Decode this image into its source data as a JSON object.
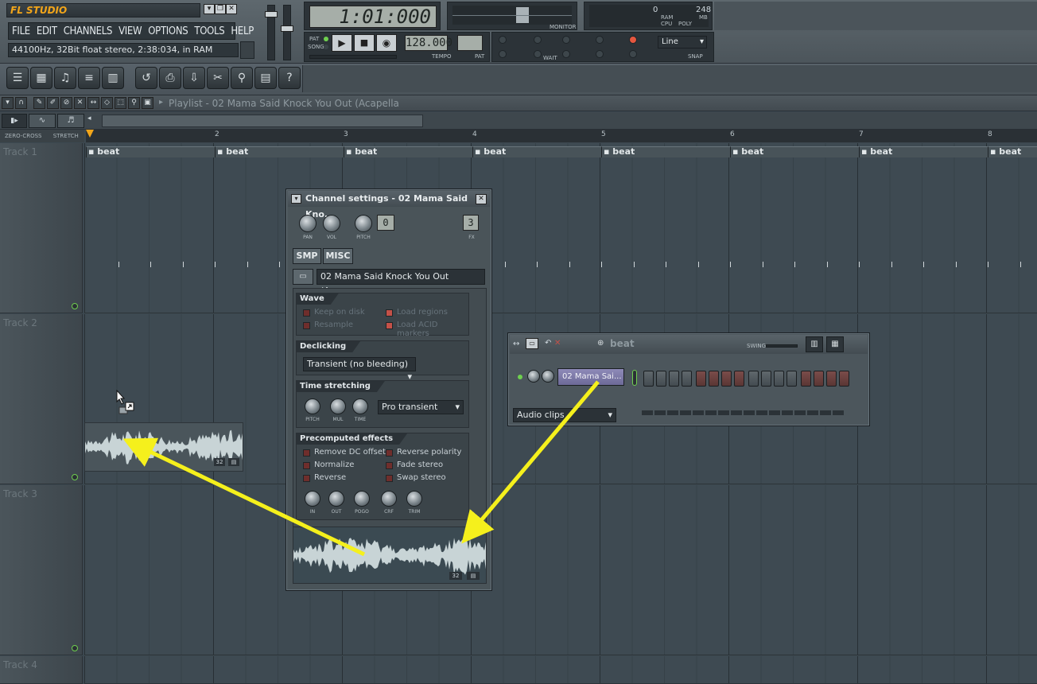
{
  "app": {
    "title": "FL STUDIO",
    "menu": [
      "FILE",
      "EDIT",
      "CHANNELS",
      "VIEW",
      "OPTIONS",
      "TOOLS",
      "HELP"
    ],
    "info": "44100Hz, 32Bit float stereo, 2:38:034, in RAM"
  },
  "transport": {
    "time": "1:01:000",
    "tempo": "128.000",
    "tempo_label": "TEMPO",
    "pat_label": "PAT",
    "song_label": "SONG",
    "pat_box_label": "PAT",
    "monitor_label": "MONITOR",
    "wait_label": "WAIT",
    "ram_value": "0",
    "ram_label": "RAM",
    "mb_label": "MB",
    "cpu_label": "CPU",
    "poly_label": "POLY",
    "poly_value": "248",
    "snap_value": "Line",
    "snap_label": "SNAP"
  },
  "playlist": {
    "title": "Playlist - 02 Mama Said Knock You Out (Acapella",
    "zero_cross": "ZERO-CROSS",
    "stretch": "STRETCH",
    "ruler": [
      "2",
      "3",
      "4",
      "5",
      "6",
      "7",
      "8"
    ],
    "pattern_label": "beat",
    "tracks": [
      "Track 1",
      "Track 2",
      "Track 3",
      "Track 4"
    ],
    "clip_badge": "32"
  },
  "channel_settings": {
    "title": "Channel settings - 02 Mama Said Kno...",
    "knobs_top": [
      "PAN",
      "VOL",
      "PITCH"
    ],
    "pitch_value": "0",
    "fx_value": "3",
    "fx_label": "FX",
    "tabs": [
      "SMP",
      "MISC"
    ],
    "sample_name": "02 Mama Said Knock You Out (Acap...",
    "wave": {
      "title": "Wave",
      "options": [
        "Keep on disk",
        "Resample",
        "Load regions",
        "Load ACID markers"
      ]
    },
    "declicking": {
      "title": "Declicking",
      "value": "Transient (no bleeding)"
    },
    "time_stretching": {
      "title": "Time stretching",
      "knobs": [
        "PITCH",
        "MUL",
        "TIME"
      ],
      "mode": "Pro transient"
    },
    "precomputed": {
      "title": "Precomputed effects",
      "options": [
        "Remove DC offset",
        "Normalize",
        "Reverse",
        "Reverse polarity",
        "Fade stereo",
        "Swap stereo"
      ],
      "knobs": [
        "IN",
        "OUT",
        "POGO",
        "CRF",
        "TRIM"
      ]
    },
    "wave_badge": "32"
  },
  "step_sequencer": {
    "pattern": "beat",
    "swing_label": "SWING",
    "channel_name": "02 Mama Sai...",
    "filter": "Audio clips",
    "steps_on": [
      0,
      0,
      0,
      0,
      1,
      1,
      1,
      1,
      0,
      0,
      0,
      0,
      1,
      1,
      1,
      1
    ]
  },
  "colors": {
    "accent": "#f2a51a",
    "arrow": "#f5f01c",
    "lane": "#3e4a52",
    "step_red": "#7b4c4a"
  }
}
